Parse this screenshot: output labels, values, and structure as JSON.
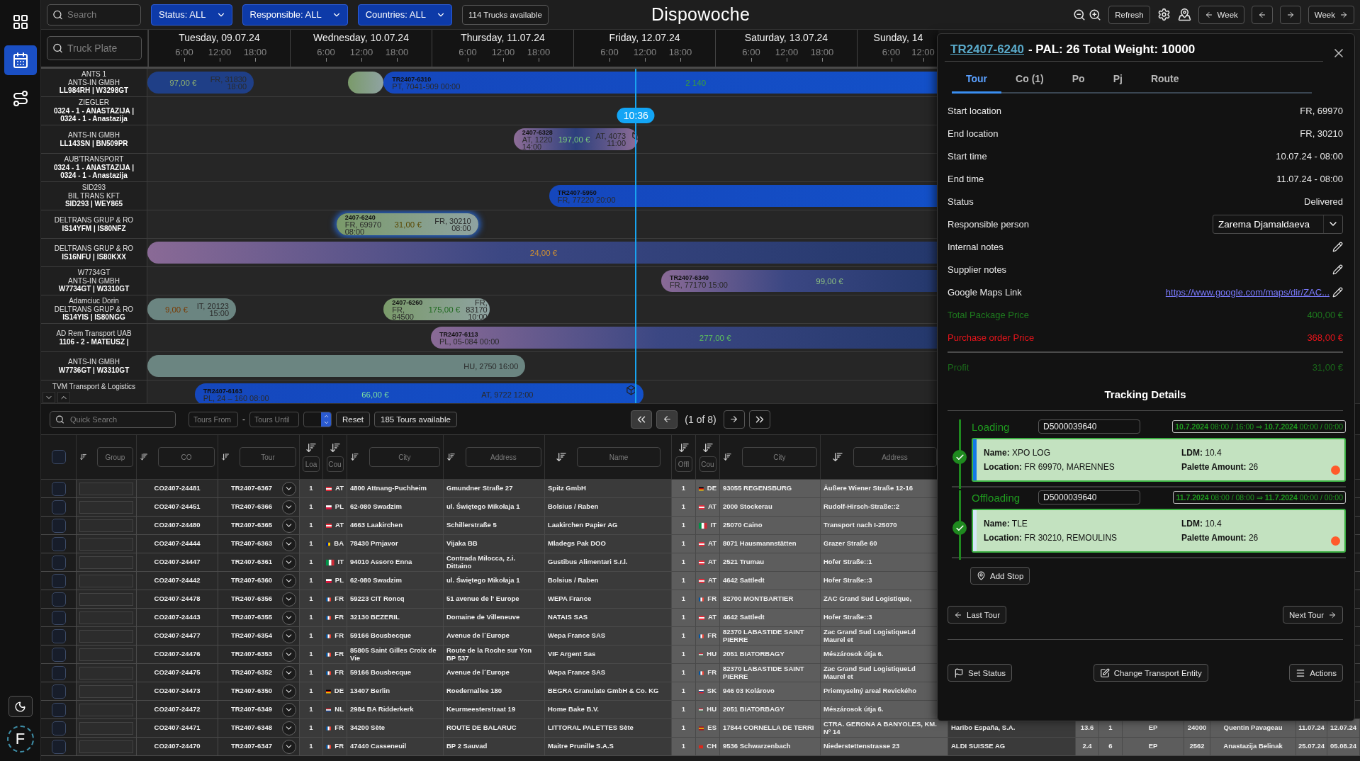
{
  "rail": {
    "items": [
      {
        "selected": false
      },
      {
        "selected": true
      },
      {
        "selected": false
      }
    ],
    "avatar": "F"
  },
  "top_bar": {
    "search": {
      "placeholder": "Search"
    },
    "filters": [
      "Status: ALL",
      "Responsible: ALL",
      "Countries: ALL"
    ],
    "trucks_badge": "114 Trucks available",
    "title": "Dispowoche",
    "refresh": "Refresh",
    "prev_week": "Week",
    "next_week": "Week"
  },
  "timeline": {
    "plate_search": {
      "placeholder": "Truck Plate"
    },
    "days": [
      {
        "label": "Tuesday, 09.07.24",
        "ticks": [
          "6:00",
          "12:00",
          "18:00"
        ]
      },
      {
        "label": "Wednesday, 10.07.24",
        "ticks": [
          "6:00",
          "12:00",
          "18:00"
        ]
      },
      {
        "label": "Thursday, 11.07.24",
        "ticks": [
          "6:00",
          "12:00",
          "18:00"
        ]
      },
      {
        "label": "Friday, 12.07.24",
        "ticks": [
          "6:00",
          "12:00",
          "18:00"
        ]
      },
      {
        "label": "Saturday, 13.07.24",
        "ticks": [
          "6:00",
          "12:00",
          "18:00"
        ]
      },
      {
        "label": "Sunday, 14",
        "ticks": [
          "6:00",
          "12:00"
        ]
      }
    ],
    "now": {
      "label": "10:36"
    },
    "rows": [
      {
        "title_lines": [
          "ANTS 1",
          "ANTS-IN GMBH"
        ],
        "plate_lines": [
          "LL984RH | W3298GT"
        ],
        "bars": [
          {
            "kind": "navy",
            "selected": false,
            "price": "97,00 €",
            "color": "#8fb070",
            "end": [
              "FR, 31830",
              "18:00"
            ]
          },
          {
            "kind": "green",
            "selected": false
          },
          {
            "kind": "blue",
            "selected": false,
            "code": "TR2407-6310",
            "start": [
              "PT, 7041-909 00:00"
            ],
            "price": "2 140",
            "color": "#3aa03a"
          }
        ]
      },
      {
        "title_lines": [
          "ZIEGLER"
        ],
        "plate_lines": [
          "0324 - 1 - ANASTAZIJA |",
          "0324 - 1 - Anastazija"
        ]
      },
      {
        "title_lines": [
          "ANTS-IN GMBH"
        ],
        "plate_lines": [
          "LL143SN | BN509PR"
        ],
        "bars": [
          {
            "kind": "purple",
            "selected": false,
            "code": "2407-6328",
            "start": [
              "AT, 1220",
              "14:00"
            ],
            "price": "197,00 €",
            "color": "#7ad07a",
            "end": [
              "AT, 4073",
              "11:00"
            ],
            "cargo": true
          }
        ]
      },
      {
        "title_lines": [
          "AUB'TRANSPORT"
        ],
        "plate_lines": [
          "0324 - 1 - ANASTAZIJA |",
          "0324 - 1 - Anastazija"
        ]
      },
      {
        "title_lines": [
          "SID293",
          "BIL TRANS KFT"
        ],
        "plate_lines": [
          "SID293 | WEY865"
        ],
        "bars": [
          {
            "kind": "blue",
            "selected": false,
            "code": "TR2407-5950",
            "start": [
              "FR, 77220 20:00"
            ]
          }
        ]
      },
      {
        "title_lines": [
          "DELTRANS GRUP & RO"
        ],
        "plate_lines": [
          "IS14YFM | IS80NFZ"
        ],
        "bars": [
          {
            "kind": "green",
            "selected": true,
            "code": "2407-6240",
            "start": [
              "FR, 69970",
              "08:00"
            ],
            "price": "31,00 €",
            "color": "#5a4800",
            "end": [
              "FR, 30210",
              "08:00"
            ]
          }
        ]
      },
      {
        "title_lines": [
          "DELTRANS GRUP & RO"
        ],
        "plate_lines": [
          "IS16NFU | IS80KXX"
        ],
        "bars": [
          {
            "kind": "fade",
            "selected": false,
            "price": "24,00 €",
            "color": "#d09030"
          }
        ]
      },
      {
        "title_lines": [
          "W7734GT",
          "ANTS-IN GMBH"
        ],
        "plate_lines": [
          "W7734GT | W3310GT"
        ],
        "bars": [
          {
            "kind": "fade",
            "selected": false,
            "code": "TR2407-6340",
            "start": [
              "FR, 77170 15:00"
            ],
            "price": "99,00 €",
            "color": "#8cc080"
          }
        ]
      },
      {
        "title_lines": [
          "Adamciuc Dorin",
          "DELTRANS GRUP & RO"
        ],
        "plate_lines": [
          "IS14YIS | IS80NGG"
        ],
        "bars": [
          {
            "kind": "grey",
            "selected": false,
            "price": "9,00 €",
            "color": "#7a3a00",
            "end": [
              "IT, 20123",
              "15:00"
            ]
          },
          {
            "kind": "green",
            "selected": false,
            "code": "2407-6260",
            "start": [
              "FR,",
              "84500"
            ],
            "price": "175,00 €",
            "color": "#1f6a1f",
            "end": [
              "FR,",
              "83170",
              "10:00"
            ]
          }
        ]
      },
      {
        "title_lines": [
          "AD Rem Transport UAB"
        ],
        "plate_lines": [
          "1106 - 2 - MATEUSZ |"
        ],
        "bars": [
          {
            "kind": "fade",
            "selected": false,
            "code": "TR2407-6113",
            "start": [
              "PL, 05-084 00:00"
            ],
            "price": "277,00 €",
            "color": "#5cc05c"
          }
        ]
      },
      {
        "title_lines": [
          "ANTS-IN GMBH"
        ],
        "plate_lines": [
          "W7736GT | W3310GT"
        ],
        "bars": [
          {
            "kind": "grey",
            "selected": false,
            "end": [
              "HU, 2750 16:00"
            ]
          }
        ]
      },
      {
        "title_lines": [
          "TVM Transport & Logistics"
        ],
        "bars": [
          {
            "kind": "blue",
            "selected": false,
            "code": "TR2407-6163",
            "start": [
              "PL, 24 – 160 08:00"
            ],
            "price": "66,00 €",
            "color": "#7ee0a0",
            "end": [
              "AT, 9722 12:00"
            ],
            "cargo": true
          }
        ]
      }
    ]
  },
  "table_toolbar": {
    "search": {
      "placeholder": "Quick Search"
    },
    "tours_from": {
      "placeholder": "Tours From"
    },
    "separator": "-",
    "tours_until": {
      "placeholder": "Tours Until"
    },
    "reset": "Reset",
    "count": "185 Tours available",
    "page": "(1 of 8)"
  },
  "table": {
    "header_checked": false,
    "columns": [
      {
        "placeholder": "Group"
      },
      {
        "placeholder": "CO"
      },
      {
        "placeholder": "Tour"
      },
      {
        "placeholder": "Loa"
      },
      {
        "placeholder": "Cou"
      },
      {
        "placeholder": "City"
      },
      {
        "placeholder": "Address"
      },
      {
        "placeholder": "Name"
      },
      {
        "placeholder": "Offl"
      },
      {
        "placeholder": "Cou"
      },
      {
        "placeholder": "City"
      },
      {
        "placeholder": "Address"
      }
    ],
    "rows": [
      {
        "checked": false,
        "co": "CO2407-24481",
        "tour": "TR2407-6367",
        "load_count": "1",
        "load_country": "AT",
        "load_city": "4800 Attnang-Puchheim",
        "load_address": "Gmundner Straße 27",
        "offload_name": "Spitz GmbH",
        "offload_count": "1",
        "offload_country": "DE",
        "offload_city": "93055 REGENSBURG",
        "offload_address": "Äußere Wiener Straße 12-16"
      },
      {
        "checked": false,
        "co": "CO2407-24451",
        "tour": "TR2407-6366",
        "load_count": "1",
        "load_country": "PL",
        "load_city": "62-080 Swadzim",
        "load_address": "ul. Świętego Mikołaja 1",
        "offload_name": "Bolsius / Raben",
        "offload_count": "1",
        "offload_country": "AT",
        "offload_city": "2000 Stockerau",
        "offload_address": "Rudolf-Hirsch-Straße::2"
      },
      {
        "checked": false,
        "co": "CO2407-24480",
        "tour": "TR2407-6365",
        "load_count": "1",
        "load_country": "AT",
        "load_city": "4663 Laakirchen",
        "load_address": "Schillerstraße 5",
        "offload_name": "Laakirchen Papier AG",
        "offload_count": "1",
        "offload_country": "IT",
        "offload_city": "25070 Caino",
        "offload_address": "Transport nach I-25070"
      },
      {
        "checked": false,
        "co": "CO2407-24444",
        "tour": "TR2407-6363",
        "load_count": "1",
        "load_country": "BA",
        "load_city": "78430 Prnjavor",
        "load_address": "Vijaka BB",
        "offload_name": "Mladegs Pak DOO",
        "offload_count": "1",
        "offload_country": "AT",
        "offload_city": "8071 Hausmannstätten",
        "offload_address": "Grazer Straße 60"
      },
      {
        "checked": false,
        "co": "CO2407-24447",
        "tour": "TR2407-6361",
        "load_count": "1",
        "load_country": "IT",
        "load_city": "94010 Assoro Enna",
        "load_address": "Contrada Milocca, z.i. Dittaino",
        "offload_name": "Gustibus Alimentari S.r.l.",
        "offload_count": "1",
        "offload_country": "AT",
        "offload_city": "2521 Trumau",
        "offload_address": "Hofer Straße::1"
      },
      {
        "checked": false,
        "co": "CO2407-24442",
        "tour": "TR2407-6360",
        "load_count": "1",
        "load_country": "PL",
        "load_city": "62-080 Swadzim",
        "load_address": "ul. Świętego Mikołaja 1",
        "offload_name": "Bolsius / Raben",
        "offload_count": "1",
        "offload_country": "AT",
        "offload_city": "4642 Sattledt",
        "offload_address": "Hofer Straße::3"
      },
      {
        "checked": false,
        "co": "CO2407-24478",
        "tour": "TR2407-6356",
        "load_count": "1",
        "load_country": "FR",
        "load_city": "59223 CIT Roncq",
        "load_address": "51 avenue de l' Europe",
        "offload_name": "WEPA France",
        "offload_count": "1",
        "offload_country": "FR",
        "offload_city": "82700 MONTBARTIER",
        "offload_address": "ZAC Grand Sud Logistique,"
      },
      {
        "checked": false,
        "co": "CO2407-24443",
        "tour": "TR2407-6355",
        "load_count": "1",
        "load_country": "FR",
        "load_city": "32130 BEZERIL",
        "load_address": "Domaine de Villeneuve",
        "offload_name": "NATAIS SAS",
        "offload_count": "1",
        "offload_country": "AT",
        "offload_city": "4642 Sattledt",
        "offload_address": "Hofer Straße::3"
      },
      {
        "checked": false,
        "co": "CO2407-24477",
        "tour": "TR2407-6354",
        "load_count": "1",
        "load_country": "FR",
        "load_city": "59166 Bousbecque",
        "load_address": "Avenue de l´Europe",
        "offload_name": "Wepa France SAS",
        "offload_count": "1",
        "offload_country": "FR",
        "offload_city": "82370 LABASTIDE SAINT PIERRE",
        "offload_address": "Zac Grand Sud LogistiqueLd Maurel et"
      },
      {
        "checked": false,
        "co": "CO2407-24476",
        "tour": "TR2407-6353",
        "load_count": "1",
        "load_country": "FR",
        "load_city": "85805 Saint Gilles Croix de Vie",
        "load_address": "Route de la Roche sur Yon BP 537",
        "offload_name": "VIF Argent Sas",
        "offload_count": "1",
        "offload_country": "HU",
        "offload_city": "2051 BIATORBAGY",
        "offload_address": "Mészárosok útja 6."
      },
      {
        "checked": false,
        "co": "CO2407-24475",
        "tour": "TR2407-6352",
        "load_count": "1",
        "load_country": "FR",
        "load_city": "59166 Bousbecque",
        "load_address": "Avenue de l´Europe",
        "offload_name": "Wepa France SAS",
        "offload_count": "1",
        "offload_country": "FR",
        "offload_city": "82370 LABASTIDE SAINT PIERRE",
        "offload_address": "Zac Grand Sud LogistiqueLd Maurel et"
      },
      {
        "checked": false,
        "co": "CO2407-24473",
        "tour": "TR2407-6350",
        "load_count": "1",
        "load_country": "DE",
        "load_city": "13407 Berlin",
        "load_address": "Roedernallee 180",
        "offload_name": "BEGRA Granulate GmbH & Co. KG",
        "offload_count": "1",
        "offload_country": "SK",
        "offload_city": "946 03 Kolárovo",
        "offload_address": "Priemyselný areal Revického"
      },
      {
        "checked": false,
        "co": "CO2407-24472",
        "tour": "TR2407-6349",
        "load_count": "1",
        "load_country": "NL",
        "load_city": "2984 BA Ridderkerk",
        "load_address": "Keurmeesterstraat 19",
        "offload_name": "Home Bake B.V.",
        "offload_count": "1",
        "offload_country": "HU",
        "offload_city": "2051 BIATORBAGY",
        "offload_address": "Mészárosok útja 6."
      },
      {
        "checked": false,
        "co": "CO2407-24471",
        "tour": "TR2407-6348",
        "load_count": "1",
        "load_country": "FR",
        "load_city": "34200 Sète",
        "load_address": "ROUTE DE BALARUC",
        "offload_name": "LITTORAL PALETTES Sète",
        "offload_count": "1",
        "offload_country": "ES",
        "offload_city": "17844 CORNELLA DE TERRI",
        "offload_address": "CTRA. GERONA A BANYOLES, KM. Nº 14",
        "extra": [
          "Haribo España, S.A.",
          "13.6",
          "1",
          "EP",
          "24000",
          "Quentin Pavageau",
          "11.07.24",
          "12.07.24"
        ]
      },
      {
        "checked": false,
        "co": "CO2407-24470",
        "tour": "TR2407-6347",
        "load_count": "1",
        "load_country": "FR",
        "load_city": "47440 Casseneuil",
        "load_address": "BP 2 Sauvad",
        "offload_name": "Maitre Prunille S.A.S",
        "offload_count": "1",
        "offload_country": "CH",
        "offload_city": "9536 Schwarzenbach",
        "offload_address": "Niederstettenstrasse 23",
        "extra": [
          "ALDI SUISSE AG",
          "2.4",
          "6",
          "EP",
          "2562",
          "Anastazija Belinak",
          "25.07.24",
          "05.08.24"
        ]
      }
    ]
  },
  "panel": {
    "tour_link": "TR2407-6240",
    "title_rest": "- PAL: 26 Total Weight: 10000",
    "tabs": [
      {
        "label": "Tour",
        "selected": true
      },
      {
        "label": "Co (1)",
        "selected": false
      },
      {
        "label": "Po",
        "selected": false
      },
      {
        "label": "Pj",
        "selected": false
      },
      {
        "label": "Route",
        "selected": false
      }
    ],
    "details": [
      {
        "kind": "text",
        "label": "Start location",
        "value": "FR, 69970"
      },
      {
        "kind": "text",
        "label": "End location",
        "value": "FR, 30210"
      },
      {
        "kind": "text",
        "label": "Start time",
        "value": "10.07.24 - 08:00"
      },
      {
        "kind": "text",
        "label": "End time",
        "value": "11.07.24 - 08:00"
      },
      {
        "kind": "text",
        "label": "Status",
        "value": "Delivered"
      },
      {
        "kind": "select",
        "label": "Responsible person",
        "value": "Zarema Djamaldaeva"
      },
      {
        "kind": "note",
        "label": "Internal notes"
      },
      {
        "kind": "note",
        "label": "Supplier notes"
      },
      {
        "kind": "link",
        "label": "Google Maps Link",
        "value": "https://www.google.com/maps/dir/ZAC..."
      },
      {
        "kind": "price",
        "label": "Total Package Price",
        "value": "400,00 €",
        "color": "#1e7a1e"
      },
      {
        "kind": "price",
        "label": "Purchase order Price",
        "value": "368,00 €",
        "color": "#e8141b"
      }
    ],
    "profit": {
      "label": "Profit",
      "value": "31,00 €",
      "color": "#1a6a1a"
    },
    "tracking_title": "Tracking Details",
    "stops": [
      {
        "label": "Loading",
        "reference": "D5000039640",
        "schedule": "**10.7.2024** 08:00 / 16:00 ⇒ **10.7.2024** 00:00 / 00:00",
        "done": true,
        "selected": true,
        "name": "**Name:** XPO LOG",
        "location": "**Location:** FR 69970, MARENNES",
        "ldm": "**LDM:** 10.4",
        "palettes": "**Palette Amount:** 26"
      },
      {
        "label": "Offloading",
        "reference": "D5000039640",
        "schedule": "**11.7.2024** 08:00 / 08:00 ⇒ **11.7.2024** 00:00 / 00:00",
        "done": true,
        "selected": false,
        "name": "**Name:** TLE",
        "location": "**Location:** FR 30210, REMOULINS",
        "ldm": "**LDM:** 10.4",
        "palettes": "**Palette Amount:** 26"
      }
    ],
    "add_stop": "Add Stop",
    "last_tour": "Last Tour",
    "next_tour": "Next Tour",
    "actions": [
      {
        "kind": "flag",
        "label": "Set Status"
      },
      {
        "kind": "edit",
        "label": "Change Transport Entity"
      },
      {
        "kind": "menu",
        "label": "Actions"
      }
    ]
  }
}
